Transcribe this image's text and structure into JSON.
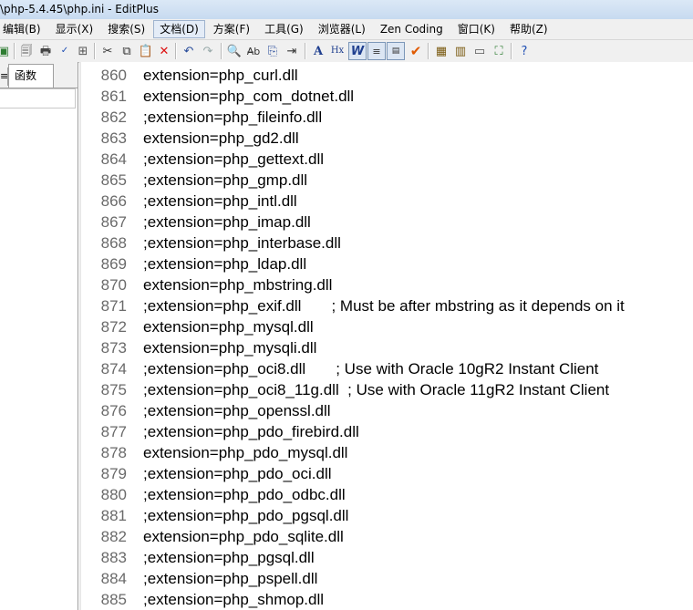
{
  "window": {
    "title": "\\php-5.4.45\\php.ini - EditPlus"
  },
  "menu": [
    "编辑(B)",
    "显示(X)",
    "搜索(S)",
    "文档(D)",
    "方案(F)",
    "工具(G)",
    "浏览器(L)",
    "Zen Coding",
    "窗口(K)",
    "帮助(Z)"
  ],
  "active_menu": "文档(D)",
  "toolbar": {
    "icons": [
      "save-all-icon",
      "print-preview-icon",
      "print-icon",
      "spell-check-icon",
      "compare-icon",
      "cut-icon",
      "copy-icon",
      "paste-icon",
      "delete-icon",
      "undo-icon",
      "redo-icon",
      "find-icon",
      "replace-icon",
      "find-in-files-icon",
      "goto-line-icon",
      "font-icon",
      "hex-view-icon",
      "word-wrap-icon",
      "line-numbers-icon",
      "column-ruler-icon",
      "check-icon",
      "cliptext-window-icon",
      "directory-window-icon",
      "output-window-icon",
      "fullscreen-icon",
      "help-icon"
    ]
  },
  "sidebar": {
    "tab_label": "函数",
    "cut_tab_glyph": "≡"
  },
  "editor": {
    "lines": [
      {
        "no": "860",
        "text": "extension=php_curl.dll"
      },
      {
        "no": "861",
        "text": "extension=php_com_dotnet.dll"
      },
      {
        "no": "862",
        "text": ";extension=php_fileinfo.dll"
      },
      {
        "no": "863",
        "text": "extension=php_gd2.dll"
      },
      {
        "no": "864",
        "text": ";extension=php_gettext.dll"
      },
      {
        "no": "865",
        "text": ";extension=php_gmp.dll"
      },
      {
        "no": "866",
        "text": ";extension=php_intl.dll"
      },
      {
        "no": "867",
        "text": ";extension=php_imap.dll"
      },
      {
        "no": "868",
        "text": ";extension=php_interbase.dll"
      },
      {
        "no": "869",
        "text": ";extension=php_ldap.dll"
      },
      {
        "no": "870",
        "text": "extension=php_mbstring.dll"
      },
      {
        "no": "871",
        "text": ";extension=php_exif.dll       ; Must be after mbstring as it depends on it"
      },
      {
        "no": "872",
        "text": "extension=php_mysql.dll"
      },
      {
        "no": "873",
        "text": "extension=php_mysqli.dll"
      },
      {
        "no": "874",
        "text": ";extension=php_oci8.dll       ; Use with Oracle 10gR2 Instant Client"
      },
      {
        "no": "875",
        "text": ";extension=php_oci8_11g.dll  ; Use with Oracle 11gR2 Instant Client"
      },
      {
        "no": "876",
        "text": ";extension=php_openssl.dll"
      },
      {
        "no": "877",
        "text": ";extension=php_pdo_firebird.dll"
      },
      {
        "no": "878",
        "text": "extension=php_pdo_mysql.dll"
      },
      {
        "no": "879",
        "text": ";extension=php_pdo_oci.dll"
      },
      {
        "no": "880",
        "text": ";extension=php_pdo_odbc.dll"
      },
      {
        "no": "881",
        "text": ";extension=php_pdo_pgsql.dll"
      },
      {
        "no": "882",
        "text": "extension=php_pdo_sqlite.dll"
      },
      {
        "no": "883",
        "text": ";extension=php_pgsql.dll"
      },
      {
        "no": "884",
        "text": ";extension=php_pspell.dll"
      },
      {
        "no": "885",
        "text": ";extension=php_shmop.dll"
      }
    ]
  }
}
